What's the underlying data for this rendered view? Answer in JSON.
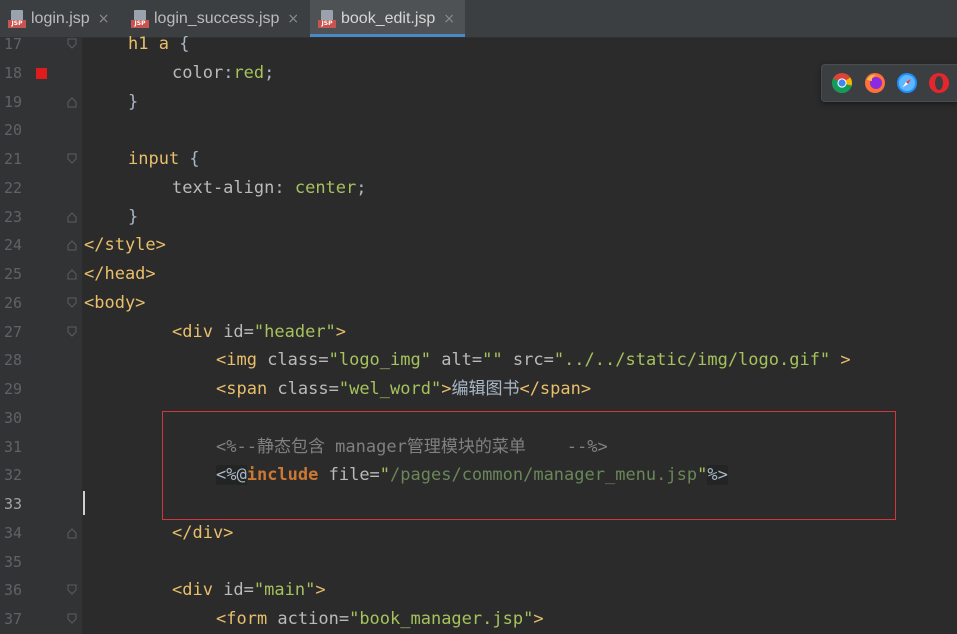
{
  "tabs": [
    {
      "label": "login.jsp",
      "icon": "jsp-file-icon",
      "active": false
    },
    {
      "label": "login_success.jsp",
      "icon": "jsp-file-icon",
      "active": false
    },
    {
      "label": "book_edit.jsp",
      "icon": "jsp-file-icon",
      "active": true
    }
  ],
  "tab_close_glyph": "×",
  "file_icon_text": "JSP",
  "browsers": [
    "chrome-icon",
    "firefox-icon",
    "safari-icon",
    "opera-icon"
  ],
  "lines": [
    {
      "num": "17",
      "text": "h1 a {"
    },
    {
      "num": "18",
      "text": "color:red;"
    },
    {
      "num": "19",
      "text": "}"
    },
    {
      "num": "20",
      "text": ""
    },
    {
      "num": "21",
      "text": "input {"
    },
    {
      "num": "22",
      "text": "text-align: center;"
    },
    {
      "num": "23",
      "text": "}"
    },
    {
      "num": "24",
      "text": "</style>"
    },
    {
      "num": "25",
      "text": "</head>"
    },
    {
      "num": "26",
      "text": "<body>"
    },
    {
      "num": "27",
      "text": "<div id=\"header\">"
    },
    {
      "num": "28",
      "text": "<img class=\"logo_img\" alt=\"\" src=\"../../static/img/logo.gif\" >"
    },
    {
      "num": "29",
      "text": "<span class=\"wel_word\">编辑图书</span>"
    },
    {
      "num": "30",
      "text": ""
    },
    {
      "num": "31",
      "text": "<%--静态包含 manager管理模块的菜单    --%>"
    },
    {
      "num": "32",
      "text": "<%@include file=\"/pages/common/manager_menu.jsp\"%>"
    },
    {
      "num": "33",
      "text": ""
    },
    {
      "num": "34",
      "text": "</div>"
    },
    {
      "num": "35",
      "text": ""
    },
    {
      "num": "36",
      "text": "<div id=\"main\">"
    },
    {
      "num": "37",
      "text": "<form action=\"book_manager.jsp\">"
    }
  ],
  "code": {
    "l17_sel": "h1 a",
    "l17_brace": " {",
    "l18_prop": "color",
    "l18_colon": ":",
    "l18_val": "red",
    "l18_semi": ";",
    "l19": "}",
    "l21_sel": "input",
    "l21_brace": " {",
    "l22_prop": "text-align",
    "l22_colon": ": ",
    "l22_val": "center",
    "l22_semi": ";",
    "l23": "}",
    "l24": "</style>",
    "l25": "</head>",
    "l26": "<body>",
    "l27_open": "<div",
    "l27_attr": " id=",
    "l27_val": "\"header\"",
    "l27_close": ">",
    "l28_open": "<img",
    "l28_a1": " class=",
    "l28_v1": "\"logo_img\"",
    "l28_a2": " alt=",
    "l28_v2": "\"\"",
    "l28_a3": " src=",
    "l28_v3": "\"../../static/img/logo.gif\"",
    "l28_close": " >",
    "l29_open": "<span",
    "l29_attr": " class=",
    "l29_val": "\"wel_word\"",
    "l29_gt": ">",
    "l29_text": "编辑图书",
    "l29_end": "</span>",
    "l31_comment": "<%--静态包含 manager管理模块的菜单    --%>",
    "l32_open": "<%@",
    "l32_dir": "include",
    "l32_attr": " file=",
    "l32_q1": "\"",
    "l32_path": "/pages/common/manager_menu.jsp",
    "l32_q2": "\"",
    "l32_close": "%>",
    "l34": "</div>",
    "l36_open": "<div",
    "l36_attr": " id=",
    "l36_val": "\"main\"",
    "l36_close": ">",
    "l37_open": "<form",
    "l37_attr": " action=",
    "l37_val": "\"book_manager.jsp\"",
    "l37_close": ">"
  },
  "colors": {
    "breakpoint": "#e01b1b",
    "highlight_box": "#d0373c",
    "active_tab_underline": "#4a88c7"
  }
}
